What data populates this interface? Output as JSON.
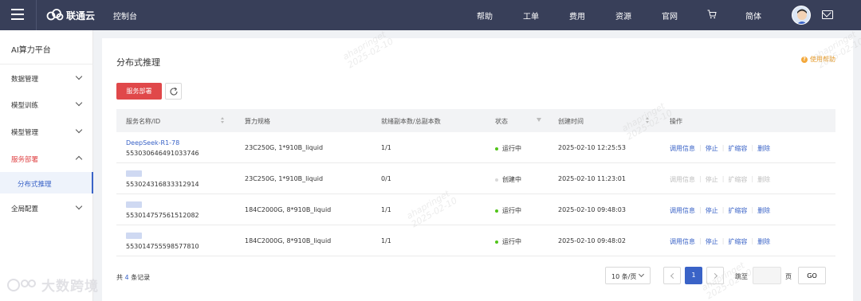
{
  "topbar": {
    "brand": "联通云",
    "console": "控制台",
    "nav": [
      "帮助",
      "工单",
      "费用",
      "资源",
      "官网",
      "简体"
    ]
  },
  "sidebar": {
    "platform_title": "AI算力平台",
    "groups": [
      {
        "label": "数据管理",
        "expanded": false
      },
      {
        "label": "模型训练",
        "expanded": false
      },
      {
        "label": "模型管理",
        "expanded": false
      },
      {
        "label": "服务部署",
        "expanded": true,
        "active": true
      },
      {
        "label": "全局配置",
        "expanded": false
      }
    ],
    "active_sub": "分布式推理"
  },
  "main": {
    "title": "分布式推理",
    "help_link": "使用帮助",
    "deploy_button": "服务部署"
  },
  "table": {
    "columns": [
      "服务名称/ID",
      "算力规格",
      "就绪副本数/总副本数",
      "状态",
      "创建时间",
      "操作"
    ],
    "rows": [
      {
        "name": "DeepSeek-R1-78",
        "id": "553030646491033746",
        "spec": "23C250G, 1*910B_liquid",
        "replicas": "1/1",
        "status": "运行中",
        "status_color": "#52c41a",
        "created": "2025-02-10 12:25:53",
        "ops_enabled": true
      },
      {
        "name": "",
        "id": "553024316833312914",
        "spec": "23C250G, 1*910B_liquid",
        "replicas": "0/1",
        "status": "创建中",
        "status_color": "#d9d9d9",
        "created": "2025-02-10 11:23:01",
        "ops_enabled": false
      },
      {
        "name": "",
        "id": "553014757561512082",
        "spec": "184C2000G, 8*910B_liquid",
        "replicas": "1/1",
        "status": "运行中",
        "status_color": "#52c41a",
        "created": "2025-02-10 09:48:03",
        "ops_enabled": true
      },
      {
        "name": "",
        "id": "553014755598577810",
        "spec": "184C2000G, 8*910B_liquid",
        "replicas": "1/1",
        "status": "运行中",
        "status_color": "#52c41a",
        "created": "2025-02-10 09:48:02",
        "ops_enabled": true
      }
    ],
    "ops": [
      "调用信息",
      "停止",
      "扩缩容",
      "删除"
    ]
  },
  "pagination": {
    "total_prefix": "共",
    "total_count": "4",
    "total_suffix": "条记录",
    "page_size": "10 条/页",
    "current_page": "1",
    "jump_label": "跳至",
    "page_unit": "页",
    "go": "GO"
  },
  "watermark": {
    "text": "ahapringet\n2025-02-10",
    "brand": "大数跨境"
  },
  "colors": {
    "topbar": "#383f59",
    "accent": "#e0484a",
    "link": "#3a63c7"
  }
}
